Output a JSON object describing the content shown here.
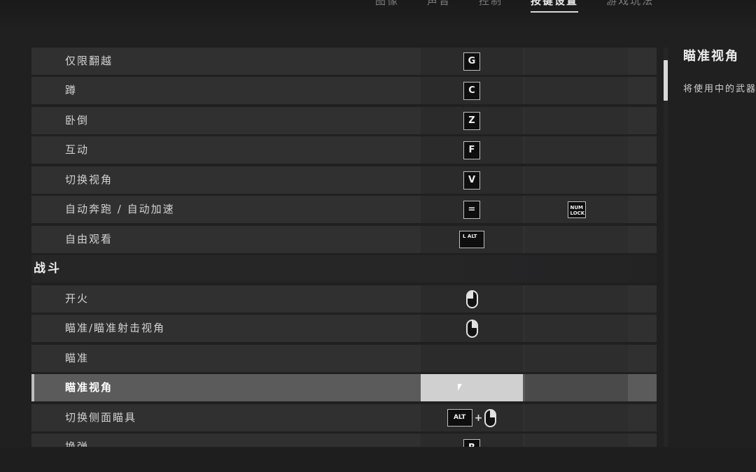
{
  "tabs": [
    {
      "label": "图像"
    },
    {
      "label": "声音"
    },
    {
      "label": "控制"
    },
    {
      "label": "按键设置",
      "active": true
    },
    {
      "label": "游戏玩法"
    }
  ],
  "rows": [
    {
      "label": "仅限翻越",
      "key1": "G"
    },
    {
      "label": "蹲",
      "key1": "C"
    },
    {
      "label": "卧倒",
      "key1": "Z"
    },
    {
      "label": "互动",
      "key1": "F"
    },
    {
      "label": "切换视角",
      "key1": "V"
    },
    {
      "label": "自动奔跑 / 自动加速",
      "key1": "=",
      "key2": "NUM LOCK"
    },
    {
      "label": "自由观看",
      "key1": "L ALT"
    },
    {
      "label": "战斗",
      "section": true
    },
    {
      "label": "开火",
      "key1_icon": "mouse-left-icon"
    },
    {
      "label": "瞄准/瞄准射击视角",
      "key1_icon": "mouse-right-icon"
    },
    {
      "label": "瞄准"
    },
    {
      "label": "瞄准视角",
      "selected": true
    },
    {
      "label": "切换侧面瞄具",
      "key1": "ALT",
      "key1_combo": "+",
      "key1_icon": "mouse-right-icon"
    },
    {
      "label": "换弹",
      "key1": "R"
    }
  ],
  "detail": {
    "title": "瞄准视角",
    "description": "将使用中的武器"
  },
  "colors": {
    "background": "#202021",
    "row": "#303031",
    "selected_row": "#5b5b5c",
    "selected_slot": "#d0d0d0"
  }
}
